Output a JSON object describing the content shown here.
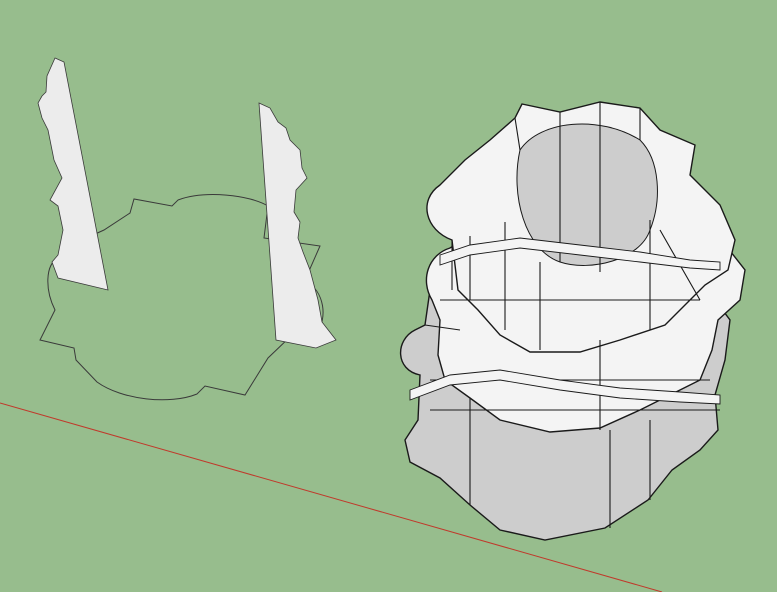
{
  "viewport": {
    "background_color": "#97bd8d",
    "axis_color": "#c0392b",
    "profile_fill": "#ececec",
    "path_stroke": "#3a3a3a",
    "model_body": "#f4f4f4",
    "model_shadow": "#cdcdcd",
    "model_edge": "#1a1a1a"
  },
  "scene_objects": [
    {
      "name": "red-axis-line",
      "kind": "axis"
    },
    {
      "name": "profile-face-left",
      "kind": "face"
    },
    {
      "name": "profile-face-right",
      "kind": "face"
    },
    {
      "name": "follow-me-path-outline",
      "kind": "edge-loop"
    },
    {
      "name": "extruded-column-model",
      "kind": "group"
    }
  ]
}
